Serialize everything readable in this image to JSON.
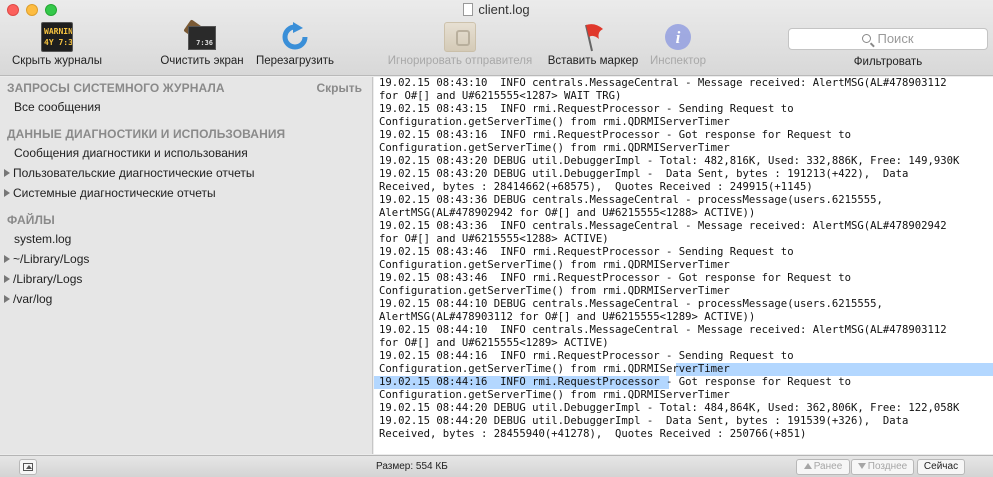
{
  "window": {
    "title": "client.log"
  },
  "toolbar": {
    "hide_logs": {
      "label": "Скрыть журналы",
      "icon": "console-icon",
      "icon_text": "WARNIN\n4Y 7:36"
    },
    "clear": {
      "label": "Очистить экран",
      "icon": "clear-screen-icon",
      "icon_text": "7:36"
    },
    "reload": {
      "label": "Перезагрузить",
      "icon": "reload-icon"
    },
    "ignore": {
      "label": "Игнорировать отправителя",
      "icon": "ignore-sender-icon",
      "disabled": true
    },
    "marker": {
      "label": "Вставить маркер",
      "icon": "flag-icon"
    },
    "inspector": {
      "label": "Инспектор",
      "icon": "info-icon",
      "disabled": true
    },
    "search": {
      "placeholder": "Поиск"
    },
    "filter": {
      "label": "Фильтровать"
    }
  },
  "sidebar": {
    "system_queries": {
      "heading": "ЗАПРОСЫ СИСТЕМНОГО ЖУРНАЛА",
      "action": "Скрыть",
      "items": [
        "Все сообщения"
      ]
    },
    "diagnostics": {
      "heading": "ДАННЫЕ ДИАГНОСТИКИ И ИСПОЛЬЗОВАНИЯ",
      "items": [
        "Сообщения диагностики и использования",
        "Пользовательские диагностические отчеты",
        "Системные диагностические отчеты"
      ]
    },
    "files": {
      "heading": "ФАЙЛЫ",
      "items": [
        "system.log",
        "~/Library/Logs",
        "/Library/Logs",
        "/var/log"
      ]
    }
  },
  "log": {
    "lines": [
      "19.02.15 08:43:10  INFO centrals.MessageCentral - Message received: AlertMSG(AL#478903112",
      "for O#[] and U#6215555<1287> WAIT TRG)",
      "19.02.15 08:43:15  INFO rmi.RequestProcessor - Sending Request to",
      "Configuration.getServerTime() from rmi.QDRMIServerTimer",
      "19.02.15 08:43:16  INFO rmi.RequestProcessor - Got response for Request to",
      "Configuration.getServerTime() from rmi.QDRMIServerTimer",
      "19.02.15 08:43:20 DEBUG util.DebuggerImpl - Total: 482,816K, Used: 332,886K, Free: 149,930K",
      "19.02.15 08:43:20 DEBUG util.DebuggerImpl -  Data Sent, bytes : 191213(+422),  Data",
      "Received, bytes : 28414662(+68575),  Quotes Received : 249915(+1145)",
      "19.02.15 08:43:36 DEBUG centrals.MessageCentral - processMessage(users.6215555,",
      "AlertMSG(AL#478902942 for O#[] and U#6215555<1288> ACTIVE))",
      "19.02.15 08:43:36  INFO centrals.MessageCentral - Message received: AlertMSG(AL#478902942",
      "for O#[] and U#6215555<1288> ACTIVE)",
      "19.02.15 08:43:46  INFO rmi.RequestProcessor - Sending Request to",
      "Configuration.getServerTime() from rmi.QDRMIServerTimer",
      "19.02.15 08:43:46  INFO rmi.RequestProcessor - Got response for Request to",
      "Configuration.getServerTime() from rmi.QDRMIServerTimer",
      "19.02.15 08:44:10 DEBUG centrals.MessageCentral - processMessage(users.6215555,",
      "AlertMSG(AL#478903112 for O#[] and U#6215555<1289> ACTIVE))",
      "19.02.15 08:44:10  INFO centrals.MessageCentral - Message received: AlertMSG(AL#478903112",
      "for O#[] and U#6215555<1289> ACTIVE)",
      "19.02.15 08:44:16  INFO rmi.RequestProcessor - Sending Request to",
      "Configuration.getServerTime() from rmi.QDRMIServerTimer",
      "19.02.15 08:44:16  INFO rmi.RequestProcessor - Got response for Request to",
      "Configuration.getServerTime() from rmi.QDRMIServerTimer",
      "19.02.15 08:44:20 DEBUG util.DebuggerImpl - Total: 484,864K, Used: 362,806K, Free: 122,058K",
      "19.02.15 08:44:20 DEBUG util.DebuggerImpl -  Data Sent, bytes : 191539(+326),  Data",
      "Received, bytes : 28455940(+41278),  Quotes Received : 250766(+851)"
    ]
  },
  "statusbar": {
    "size": "Размер: 554 КБ",
    "earlier": "Ранее",
    "later": "Позднее",
    "now": "Сейчас"
  },
  "colors": {
    "selection": "#b3d7ff",
    "background": "#ececec"
  }
}
